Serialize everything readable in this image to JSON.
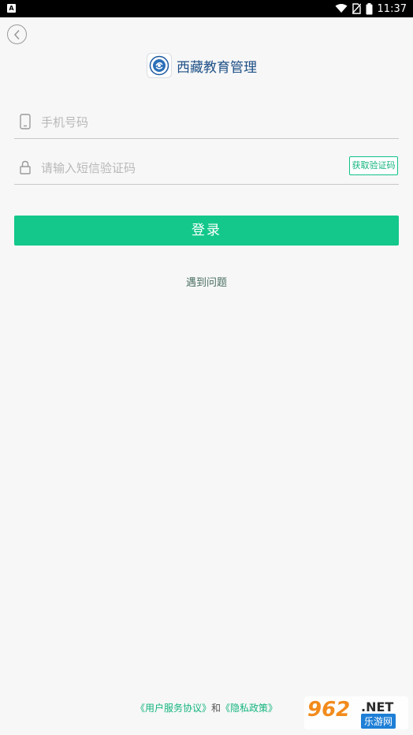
{
  "status_bar": {
    "app_indicator": "A",
    "time": "11:37"
  },
  "header": {
    "title": "西藏教育管理",
    "back_icon": "chevron-left-icon",
    "logo_icon": "app-logo"
  },
  "form": {
    "phone": {
      "placeholder": "手机号码",
      "value": "",
      "icon": "phone-icon"
    },
    "code": {
      "placeholder": "请输入短信验证码",
      "value": "",
      "icon": "lock-icon"
    },
    "get_code_label": "获取验证码",
    "login_label": "登录",
    "problem_link": "遇到问题"
  },
  "footer": {
    "agreement_link": "《用户服务协议》",
    "conjunction": "和",
    "privacy_link": "《隐私政策》"
  },
  "watermark": {
    "number": "962",
    "suffix": ".NET",
    "site": "乐游网"
  },
  "colors": {
    "accent": "#13c88a",
    "title": "#1d4f86",
    "background": "#f7f7f7"
  }
}
